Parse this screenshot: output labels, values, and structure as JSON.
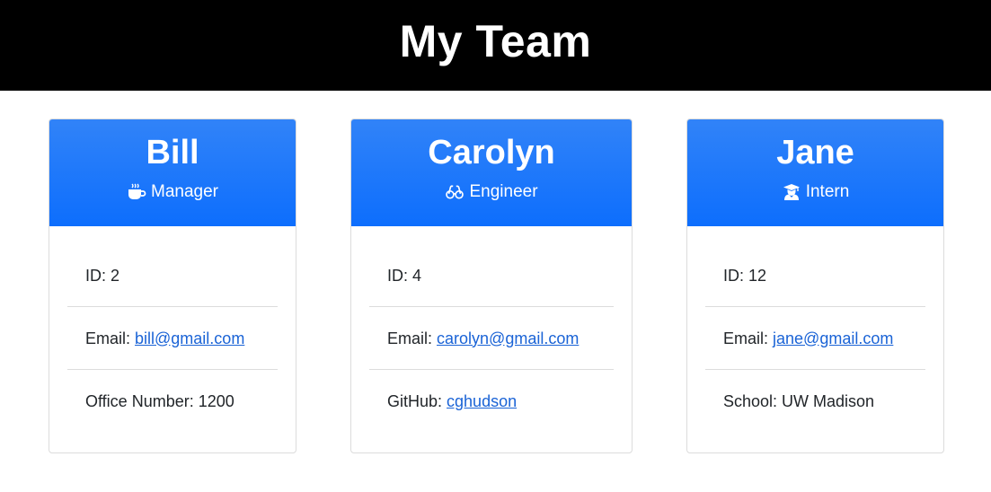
{
  "header": {
    "title": "My Team"
  },
  "cards": [
    {
      "name": "Bill",
      "role": "Manager",
      "role_icon": "coffee-mug-icon",
      "rows": [
        {
          "label": "ID:",
          "value": "2"
        },
        {
          "label": "Email:",
          "value": "bill@gmail.com",
          "link": true
        },
        {
          "label": "Office Number:",
          "value": "1200"
        }
      ]
    },
    {
      "name": "Carolyn",
      "role": "Engineer",
      "role_icon": "glasses-icon",
      "rows": [
        {
          "label": "ID:",
          "value": "4"
        },
        {
          "label": "Email:",
          "value": "carolyn@gmail.com",
          "link": true
        },
        {
          "label": "GitHub:",
          "value": "cghudson",
          "link": true
        }
      ]
    },
    {
      "name": "Jane",
      "role": "Intern",
      "role_icon": "graduate-icon",
      "rows": [
        {
          "label": "ID:",
          "value": "12"
        },
        {
          "label": "Email:",
          "value": "jane@gmail.com",
          "link": true
        },
        {
          "label": "School:",
          "value": "UW Madison"
        }
      ]
    }
  ],
  "colors": {
    "banner": "#000000",
    "card_header": "#0d6efd",
    "link": "#1a63d6"
  }
}
